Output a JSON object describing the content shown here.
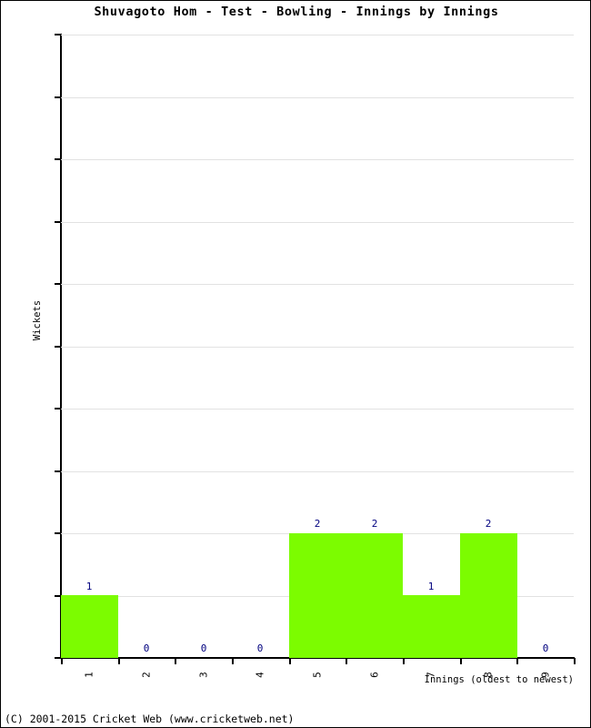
{
  "chart_data": {
    "type": "bar",
    "title": "Shuvagoto Hom - Test - Bowling - Innings by Innings",
    "xlabel": "Innings (oldest to newest)",
    "ylabel": "Wickets",
    "categories": [
      "1",
      "2",
      "3",
      "4",
      "5",
      "6",
      "7",
      "8",
      "9"
    ],
    "values": [
      1,
      0,
      0,
      0,
      2,
      2,
      1,
      2,
      0
    ],
    "data_labels": [
      "1",
      "0",
      "0",
      "0",
      "2",
      "2",
      "1",
      "2",
      "0"
    ],
    "ylim": [
      0,
      10
    ],
    "ytick_labels": [
      "0",
      "1",
      "2",
      "3",
      "4",
      "5",
      "6",
      "7",
      "8",
      "9",
      "10"
    ],
    "ytick_values": [
      0,
      1,
      2,
      3,
      4,
      5,
      6,
      7,
      8,
      9,
      10
    ],
    "grid": true,
    "legend": false,
    "bar_color": "#7cfc00",
    "data_label_color": "#00007f",
    "gridline_color": "#e2e2e2",
    "axis_color": "#000000",
    "bar_width_ratio": 1.0
  },
  "footer": {
    "copyright": "(C) 2001-2015 Cricket Web (www.cricketweb.net)"
  }
}
